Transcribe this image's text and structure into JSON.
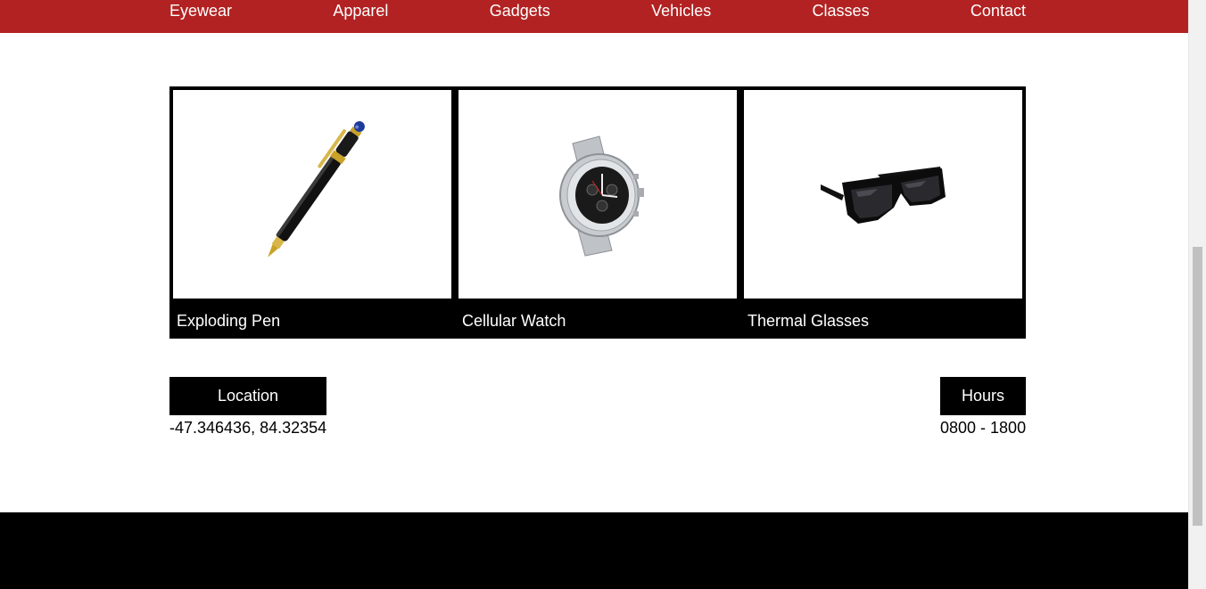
{
  "nav": {
    "items": [
      {
        "label": "Eyewear"
      },
      {
        "label": "Apparel"
      },
      {
        "label": "Gadgets"
      },
      {
        "label": "Vehicles"
      },
      {
        "label": "Classes"
      },
      {
        "label": "Contact"
      }
    ]
  },
  "products": [
    {
      "name": "Exploding Pen",
      "icon": "pen-image"
    },
    {
      "name": "Cellular Watch",
      "icon": "watch-image"
    },
    {
      "name": "Thermal Glasses",
      "icon": "sunglasses-image"
    }
  ],
  "location": {
    "title": "Location",
    "value": "-47.346436, 84.32354"
  },
  "hours": {
    "title": "Hours",
    "value": "0800 - 1800"
  },
  "colors": {
    "nav_bg": "#b22222",
    "accent": "#000000",
    "text_on_dark": "#ffffff"
  }
}
